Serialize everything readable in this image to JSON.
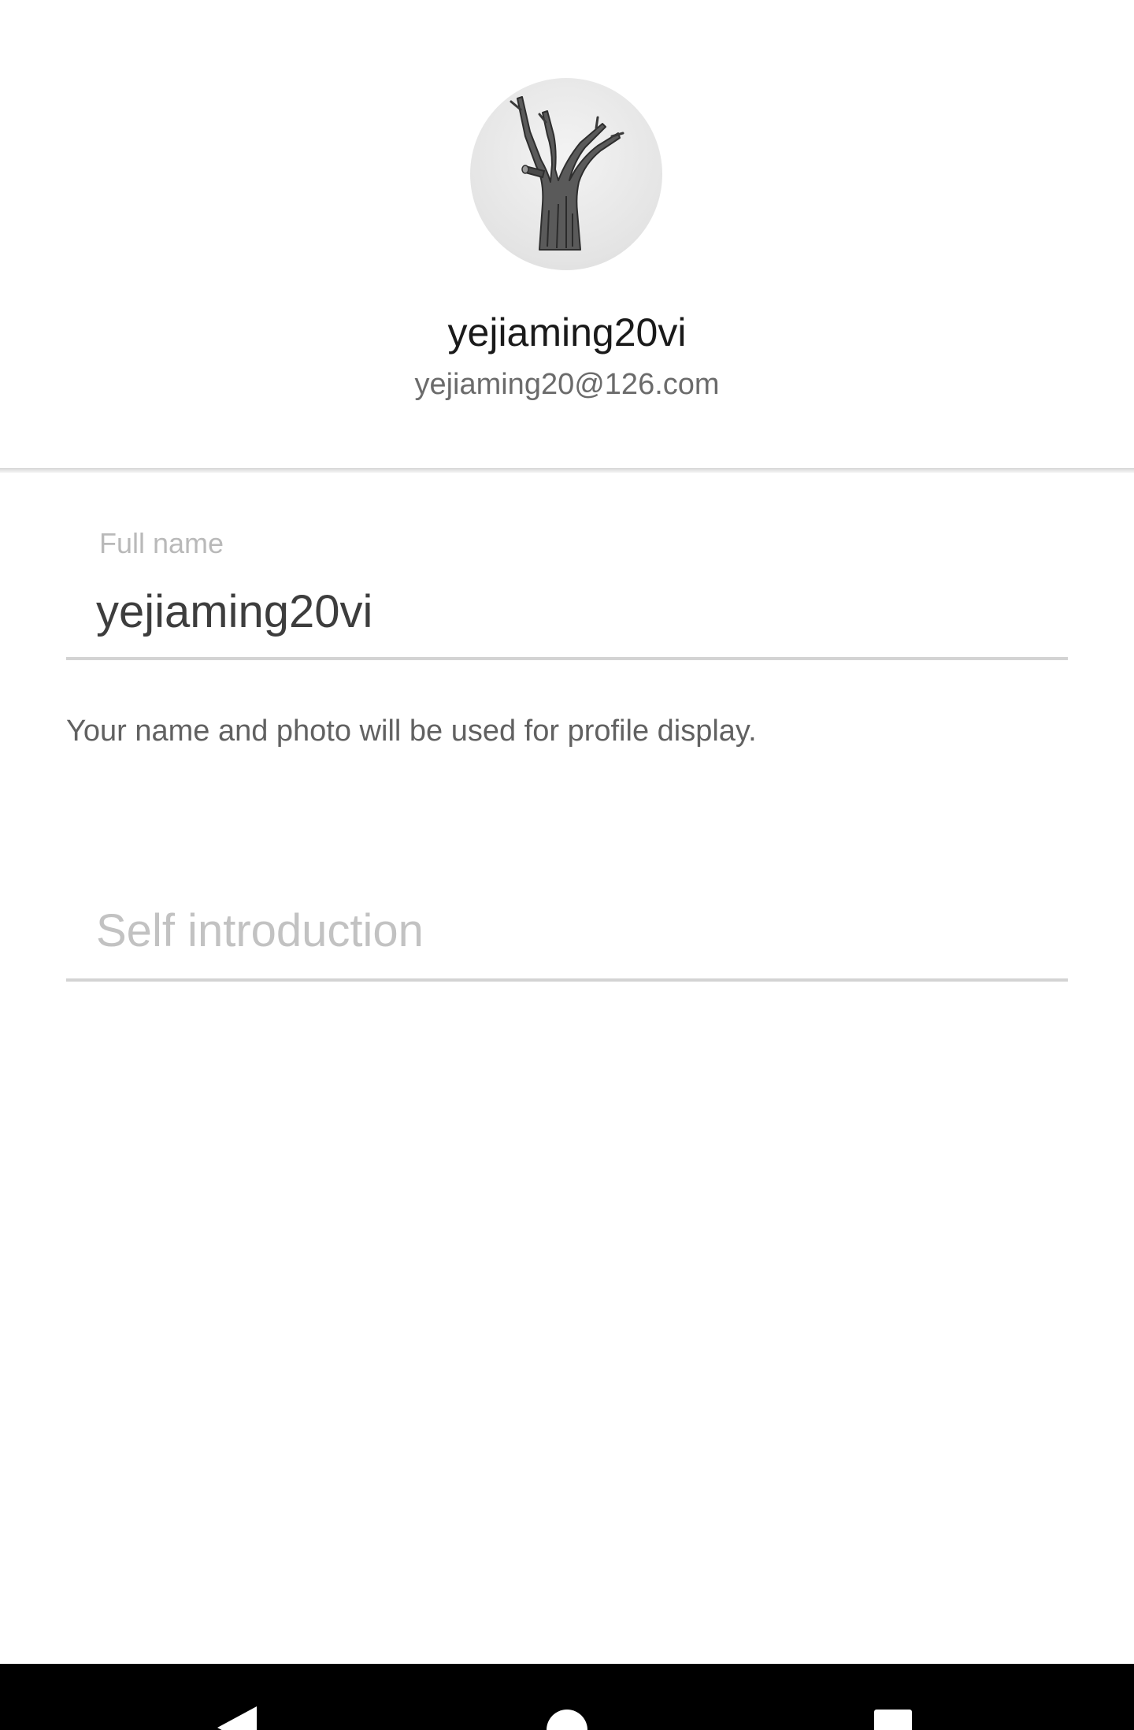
{
  "profile": {
    "display_name": "yejiaming20vi",
    "email": "yejiaming20@126.com",
    "avatar_icon": "tree-avatar"
  },
  "form": {
    "full_name_label": "Full name",
    "full_name_value": "yejiaming20vi",
    "helper_text": "Your name and photo will be used for profile display.",
    "self_intro_placeholder": "Self introduction",
    "self_intro_value": ""
  },
  "nav_bar": {
    "back_icon": "back-triangle-icon",
    "home_icon": "home-circle-icon",
    "recents_icon": "recents-square-icon"
  },
  "colors": {
    "background": "#ffffff",
    "nav_bar": "#000000",
    "underline": "#d3d3d3",
    "label": "#b9b9b9"
  }
}
